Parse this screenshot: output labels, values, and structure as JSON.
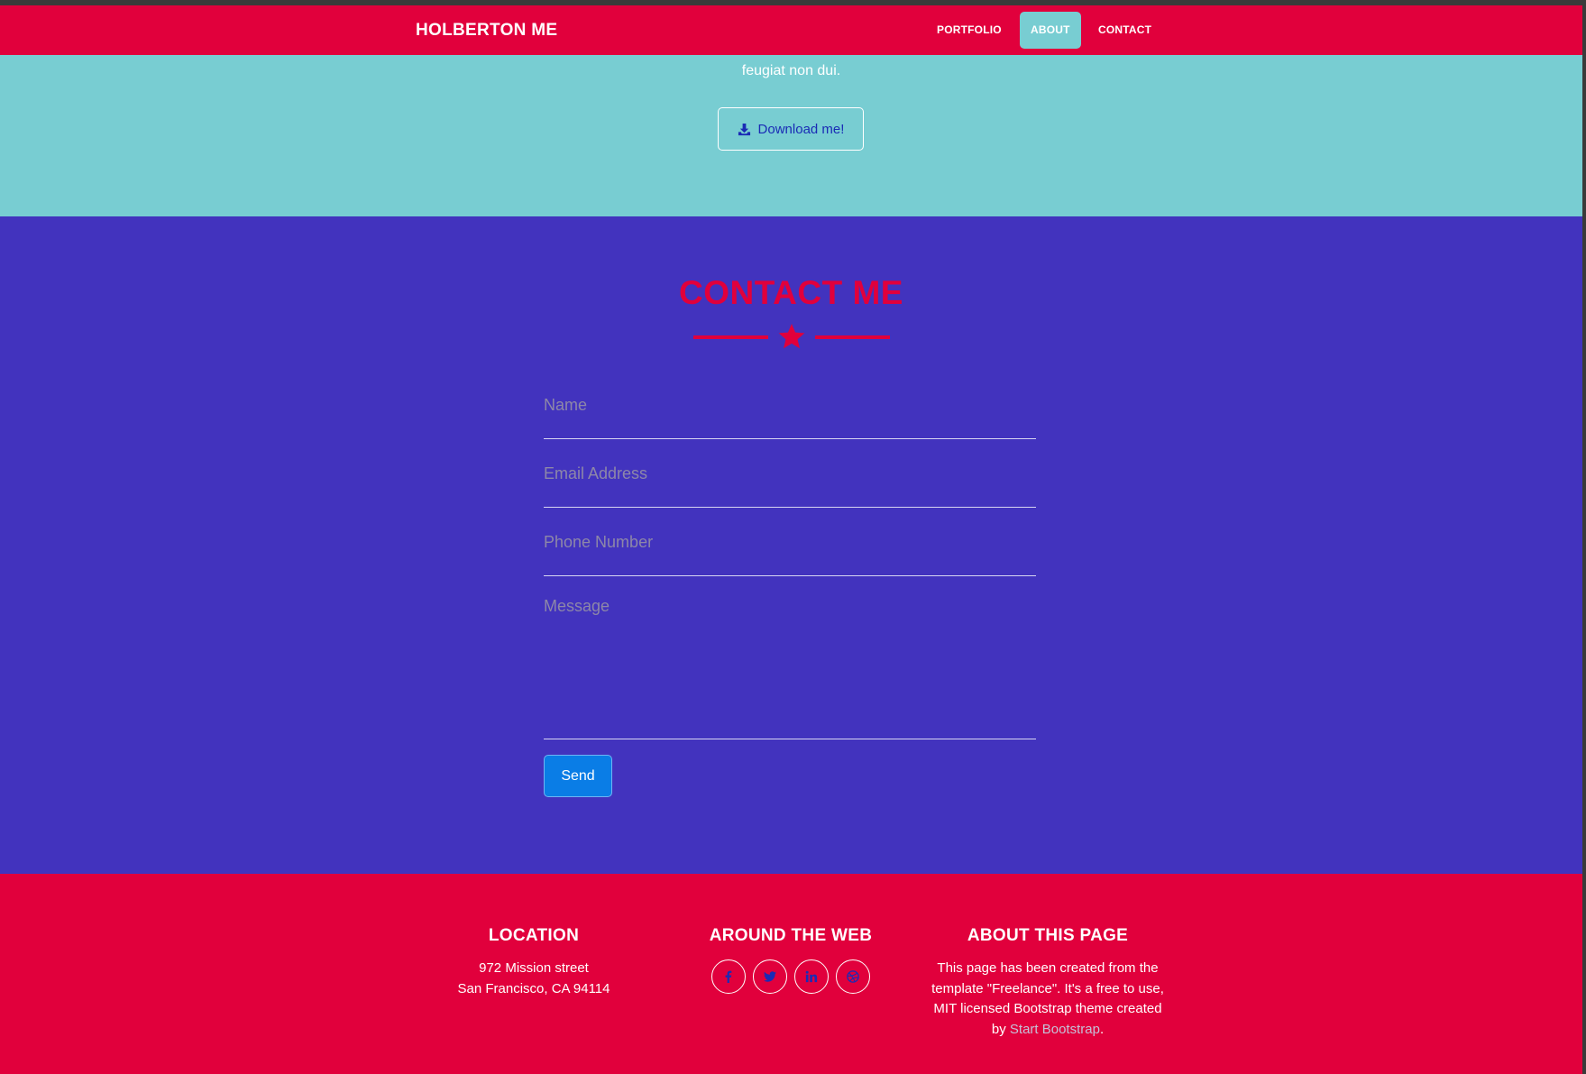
{
  "about": {
    "tail_text": "feugiat non dui.",
    "download_label": "Download me!"
  },
  "navbar": {
    "brand": "HOLBERTON ME",
    "items": [
      {
        "label": "PORTFOLIO",
        "active": false
      },
      {
        "label": "ABOUT",
        "active": true
      },
      {
        "label": "CONTACT",
        "active": false
      }
    ]
  },
  "contact": {
    "title": "CONTACT ME",
    "fields": {
      "name_placeholder": "Name",
      "email_placeholder": "Email Address",
      "phone_placeholder": "Phone Number",
      "message_placeholder": "Message"
    },
    "send_label": "Send"
  },
  "footer": {
    "location": {
      "heading": "LOCATION",
      "line1": "972 Mission street",
      "line2": "San Francisco, CA 94114"
    },
    "web": {
      "heading": "AROUND THE WEB",
      "icons": [
        "facebook-icon",
        "twitter-icon",
        "linkedin-icon",
        "dribbble-icon"
      ]
    },
    "about_page": {
      "heading": "ABOUT THIS PAGE",
      "line1": "This page has been created from the",
      "line2": "template \"Freelance\". It's a free to use,",
      "line3": "MIT licensed Bootstrap theme created",
      "line4_prefix": "by ",
      "link": "Start Bootstrap",
      "line4_suffix": "."
    }
  },
  "colors": {
    "primary": "#e1003c",
    "teal": "#78cdd2",
    "contact_bg": "#4233be",
    "send_button": "#0a7de6"
  }
}
